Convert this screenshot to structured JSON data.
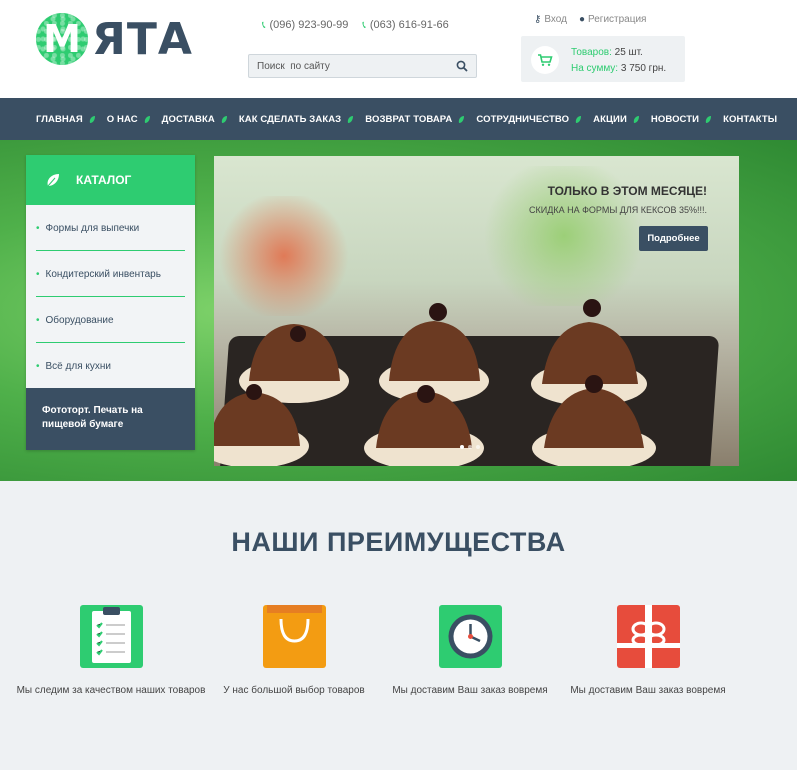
{
  "header": {
    "logo_letter": "М",
    "logo_text": "ЯТА",
    "phones": [
      "(096) 923-90-99",
      "(063) 616-91-66"
    ],
    "search_placeholder": "Поиск  по сайту",
    "login_label": "Вход",
    "register_label": "Регистрация",
    "cart": {
      "items_label": "Товаров:",
      "items_value": "25 шт.",
      "sum_label": "На сумму:",
      "sum_value": "3 750 грн."
    }
  },
  "nav": {
    "items": [
      "ГЛАВНАЯ",
      "О НАС",
      "ДОСТАВКА",
      "КАК СДЕЛАТЬ ЗАКАЗ",
      "ВОЗВРАТ ТОВАРА",
      "СОТРУДНИЧЕСТВО",
      "АКЦИИ",
      "НОВОСТИ",
      "КОНТАКТЫ"
    ]
  },
  "catalog": {
    "title": "КАТАЛОГ",
    "items": [
      "Формы для выпечки",
      "Кондитерский инвентарь",
      "Оборудование",
      "Всё для кухни"
    ],
    "special": "Фототорт. Печать на пищевой бумаге"
  },
  "slider": {
    "title": "ТОЛЬКО В ЭТОМ МЕСЯЦЕ!",
    "subtitle": "СКИДКА НА ФОРМЫ ДЛЯ КЕКСОВ 35%!!!.",
    "button": "Подробнее",
    "dots": 3,
    "active_dot": 1
  },
  "advantages": {
    "title": "НАШИ ПРЕИМУЩЕСТВА",
    "items": [
      {
        "icon": "clipboard-checklist-icon",
        "text": "Мы следим за качеством наших товаров"
      },
      {
        "icon": "shopping-bag-icon",
        "text": "У нас большой выбор товаров"
      },
      {
        "icon": "clock-icon",
        "text": "Мы доставим Ваш заказ вовремя"
      },
      {
        "icon": "gift-box-icon",
        "text": "Мы доставим Ваш заказ вовремя"
      }
    ]
  },
  "colors": {
    "brand_green": "#2ecc71",
    "dark_navy": "#3a4f63",
    "light_gray": "#eef1f3",
    "orange": "#f39c12",
    "red": "#e74c3c"
  }
}
